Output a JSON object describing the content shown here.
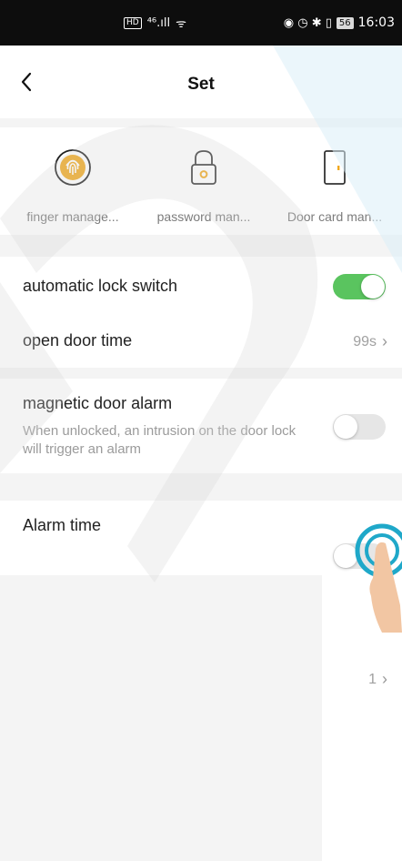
{
  "status_bar": {
    "left_badge": "HD",
    "signal": "⁴⁶.ıll",
    "wifi": "ᯤ",
    "right_icons": "◉ ◷ ✱ ▯",
    "battery": "56",
    "time": "16:03"
  },
  "header": {
    "title": "Set"
  },
  "tools": [
    {
      "label": "finger manage..."
    },
    {
      "label": "password man..."
    },
    {
      "label": "Door card man..."
    }
  ],
  "settings": {
    "auto_lock": {
      "label": "automatic lock switch",
      "enabled": true
    },
    "open_door_time": {
      "label": "open door time",
      "value": "99s"
    },
    "magnetic_alarm": {
      "label": "magnetic door alarm",
      "description": "When unlocked, an intrusion on the door lock will trigger an alarm",
      "enabled": false
    },
    "alarm_time": {
      "label": "Alarm time",
      "enabled": false,
      "value": "1"
    }
  },
  "colors": {
    "accent_green": "#5ac45f",
    "fingerprint_orange": "#f0a81e",
    "lock_orange": "#f0a81e",
    "watermark": "#e9e9e9",
    "watermark_blue": "#eaf4fb",
    "tap_ring": "#1fa8c9"
  },
  "icons": {
    "back": "chevron-left-icon",
    "finger": "fingerprint-icon",
    "password": "lock-icon",
    "door_card": "door-card-icon"
  }
}
